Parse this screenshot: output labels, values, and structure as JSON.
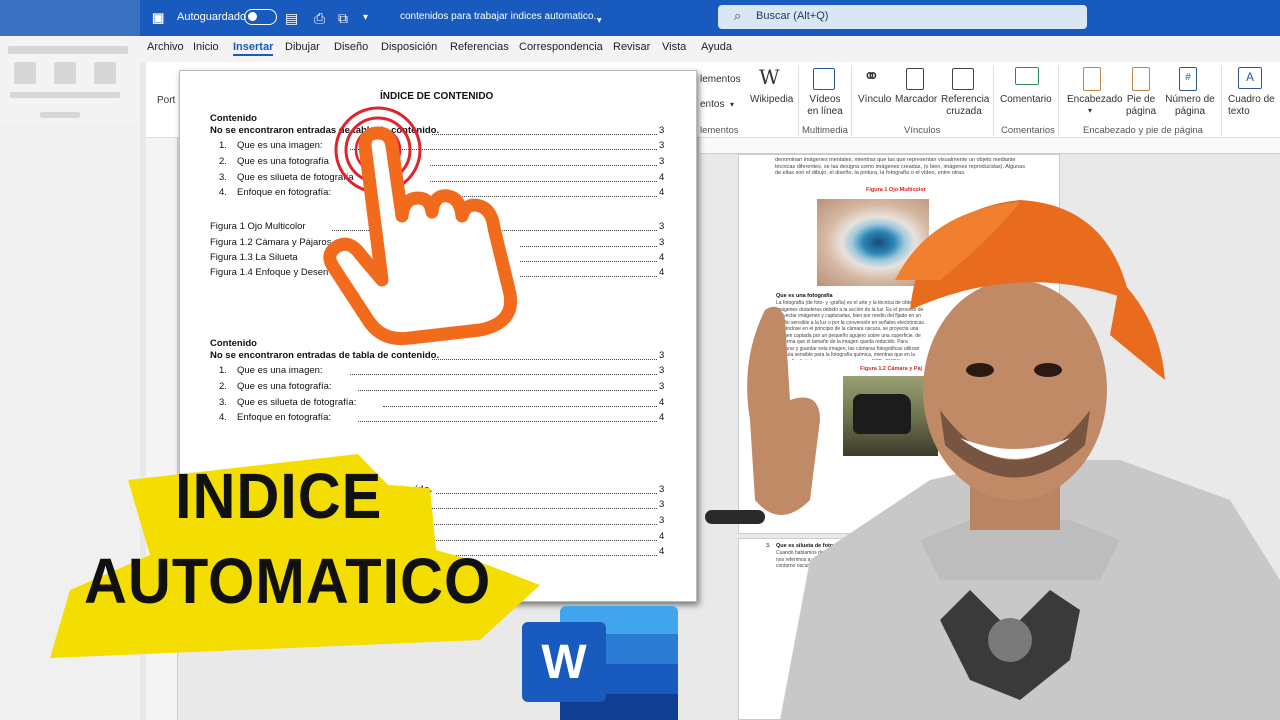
{
  "titlebar": {
    "autosave": "Autoguardado",
    "filename": "contenidos para trabajar indices automatico...",
    "search": "Buscar (Alt+Q)"
  },
  "menu": [
    "Archivo",
    "Inicio",
    "Insertar",
    "Dibujar",
    "Diseño",
    "Disposición",
    "Referencias",
    "Correspondencia",
    "Revisar",
    "Vista",
    "Ayuda"
  ],
  "ribbon": {
    "port": "Port",
    "elementos1": "lementos",
    "elementos2": "entos",
    "elementos3": "lementos",
    "wikipedia": "Wikipedia",
    "videos": "Vídeos en línea",
    "multimedia": "Multimedia",
    "vinculo": "Vínculo",
    "marcador": "Marcador",
    "referencia": "Referencia cruzada",
    "vinculos": "Vínculos",
    "comentario": "Comentario",
    "comentarios": "Comentarios",
    "encabezado": "Encabezado",
    "pie": "Pie de página",
    "numero": "Número de página",
    "grupo_enc": "Encabezado y pie de página",
    "cuadro": "Cuadro de texto"
  },
  "doc": {
    "title": "ÍNDICE DE CONTENIDO",
    "block1": {
      "heading": "Contenido",
      "noentries": "No se encontraron entradas de tabla de contenido.",
      "items": [
        {
          "n": "1.",
          "t": "Que es una imagen:",
          "p": "3"
        },
        {
          "n": "2.",
          "t": "Que es una fotografía",
          "p": "3"
        },
        {
          "n": "3.",
          "t": "Que es silueta de fotografía",
          "p": "4"
        },
        {
          "n": "4.",
          "t": "Enfoque en fotografía:",
          "p": "4"
        }
      ]
    },
    "figures": [
      {
        "t": "Figura 1 Ojo Multicolor",
        "p": "3"
      },
      {
        "t": "Figura 1.2 Cámara y Pájaros",
        "p": "3"
      },
      {
        "t": "Figura 1.3 La Silueta",
        "p": "4"
      },
      {
        "t": "Figura 1.4 Enfoque y Desen",
        "p": "4"
      }
    ],
    "block2": {
      "heading": "Contenido",
      "noentries": "No se encontraron entradas de tabla de contenido.",
      "items": [
        {
          "n": "1.",
          "t": "Que es una imagen:",
          "p": "3"
        },
        {
          "n": "2.",
          "t": "Que es una fotografía:",
          "p": "3"
        },
        {
          "n": "3.",
          "t": "Que es silueta de fotografía:",
          "p": "4"
        },
        {
          "n": "4.",
          "t": "Enfoque en fotografía:",
          "p": "4"
        }
      ]
    },
    "block3": {
      "tail": "contenido.",
      "pages": [
        "3",
        "3",
        "3",
        "4",
        "4"
      ]
    },
    "first_page_num": "3",
    "first_noentry_page": "3",
    "block2_noentry_page": "3"
  },
  "right_page": {
    "fig1_caption": "Figura 1 Ojo Multicolor",
    "section": "Que es una fotografía",
    "fig2_caption": "Figura 1.2 Cámara y Páj",
    "section3": "Que es silueta de fotografía",
    "section3_num": "3.",
    "text_top": "denominan imágenes mentales, mientras que las que representan visualmente un objeto mediante técnicas diferentes, se las designa como imágenes creadas, (o bien, imágenes reproducidas). Algunas de ellas son el dibujo, el diseño, la pintura, la fotografía o el vídeo, entre otras.",
    "text_mid": "La fotografía (de foto- y -grafía) es el arte y la técnica de obtener imágenes duraderas debido a la acción de la luz. Es el proceso de proyectar imágenes y capturarlas, bien por medio del fijado en un medio sensible a la luz o por la conversión en señales electrónicas. Basándose en el principio de la cámara oscura, se proyecta una imagen captada por un pequeño agujero sobre una superficie, de tal forma que el tamaño de la imagen queda reducido. Para capturar y guardar esta imagen, las cámaras fotográficas utilizan película sensible para la fotografía química, mientras que en la fotografía digital se emplean sensores tipo CCD, CMOS, etc. que graban según el caso. El término fotografía sirve para denominar tanto al conjunto del proceso de obtención de esta imagen como a su resultado: las propias imágenes obtenidas o «fotografías».",
    "text_bot": "Cuando hablamos de silueta nos referimos a un dibujo de contorno oscuro sobre un fondo claro o que esté muy iluminado. Su forma convertirá en una forma."
  },
  "banner": {
    "line1": "INDICE",
    "line2": "AUTOMATICO"
  },
  "colors": {
    "word_blue": "#185abd",
    "banner_yellow": "#f4dd00",
    "cursor_orange": "#f26b1d",
    "cursor_ring": "#e0242b"
  },
  "icons": [
    "word-logo-icon",
    "hand-pointer-icon",
    "search-icon",
    "save-icon",
    "wikipedia-icon",
    "video-icon",
    "link-icon",
    "bookmark-icon",
    "cross-reference-icon",
    "comment-icon",
    "header-icon",
    "footer-icon",
    "page-number-icon",
    "textbox-icon"
  ]
}
